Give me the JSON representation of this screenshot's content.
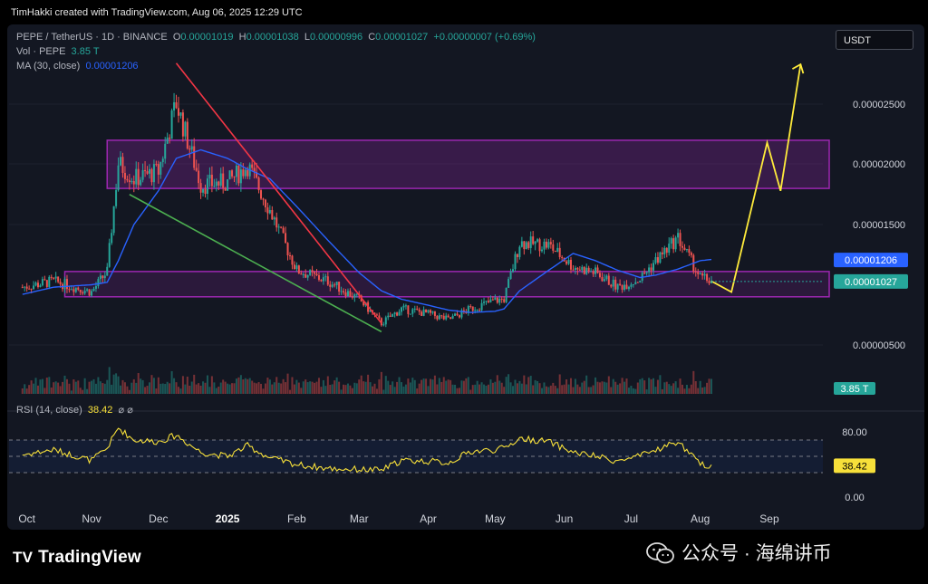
{
  "header": {
    "created_by": "TimHakki created with TradingView.com, Aug 06, 2025 12:29 UTC"
  },
  "symbol_line": {
    "pair": "PEPE / TetherUS · 1D · BINANCE",
    "o_label": "O",
    "o": "0.00001019",
    "h_label": "H",
    "h": "0.00001038",
    "l_label": "L",
    "l": "0.00000996",
    "c_label": "C",
    "c": "0.00001027",
    "change": "+0.00000007 (+0.69%)"
  },
  "volume_line": {
    "label": "Vol · PEPE",
    "value": "3.85 T"
  },
  "ma_line": {
    "label": "MA (30, close)",
    "value": "0.00001206"
  },
  "rsi_line": {
    "label": "RSI (14, close)",
    "value": "38.42",
    "icons": "⌀ ⌀"
  },
  "currency_button": "USDT",
  "price_axis": {
    "ticks": [
      "0.00002500",
      "0.00002000",
      "0.00001500",
      "0.00000500"
    ],
    "ma_badge": "0.00001206",
    "price_badge": "0.00001027",
    "volume_badge": "3.85 T"
  },
  "rsi_axis": {
    "ticks": [
      "80.00",
      "0.00"
    ],
    "rsi_badge": "38.42"
  },
  "time_axis": [
    "Oct",
    "Nov",
    "Dec",
    "2025",
    "Feb",
    "Mar",
    "Apr",
    "May",
    "Jun",
    "Jul",
    "Aug",
    "Sep"
  ],
  "branding": {
    "logo_text": "TradingView",
    "wechat_text": "公众号 · 海绵讲币"
  },
  "colors": {
    "up": "#26a69a",
    "down": "#ef5350",
    "ma": "#2962ff",
    "rsi": "#f7e03a",
    "zone": "#9c27b0",
    "projection": "#ffeb3b"
  },
  "chart_data": {
    "type": "candlestick",
    "title": "PEPE / TetherUS · 1D · BINANCE",
    "x": [
      "2024-10-01",
      "2024-10-15",
      "2024-11-01",
      "2024-11-08",
      "2024-11-13",
      "2024-11-20",
      "2024-12-01",
      "2024-12-09",
      "2024-12-20",
      "2025-01-01",
      "2025-01-10",
      "2025-01-20",
      "2025-02-01",
      "2025-02-15",
      "2025-03-01",
      "2025-03-11",
      "2025-03-20",
      "2025-04-01",
      "2025-04-10",
      "2025-04-20",
      "2025-05-01",
      "2025-05-05",
      "2025-05-12",
      "2025-05-25",
      "2025-06-05",
      "2025-06-15",
      "2025-06-25",
      "2025-07-05",
      "2025-07-12",
      "2025-07-22",
      "2025-08-01",
      "2025-08-06"
    ],
    "close": [
      9.8e-06,
      1.03e-05,
      9.4e-06,
      1.11e-05,
      2.01e-05,
      1.88e-05,
      1.94e-05,
      2.51e-05,
      1.83e-05,
      1.85e-05,
      1.99e-05,
      1.62e-05,
      1.12e-05,
      1.03e-05,
      8.8e-06,
      6.8e-06,
      8e-06,
      7.6e-06,
      7.1e-06,
      8e-06,
      8.7e-06,
      8.8e-06,
      1.35e-05,
      1.33e-05,
      1.15e-05,
      1.1e-05,
      9.8e-06,
      1.05e-05,
      1.2e-05,
      1.39e-05,
      1.06e-05,
      1.03e-05
    ],
    "ma30": [
      9.2e-06,
      9.8e-06,
      1e-05,
      1.02e-05,
      1.2e-05,
      1.5e-05,
      1.78e-05,
      2.05e-05,
      2.12e-05,
      2.05e-05,
      1.96e-05,
      1.88e-05,
      1.65e-05,
      1.37e-05,
      1.1e-05,
      9.5e-06,
      8.8e-06,
      8.3e-06,
      7.9e-06,
      7.7e-06,
      7.8e-06,
      8e-06,
      9.5e-06,
      1.12e-05,
      1.26e-05,
      1.2e-05,
      1.12e-05,
      1.06e-05,
      1.08e-05,
      1.13e-05,
      1.2e-05,
      1.21e-05
    ],
    "volume_last": "3.85 T",
    "rsi14": [
      52,
      58,
      45,
      60,
      85,
      70,
      68,
      76,
      55,
      50,
      63,
      48,
      40,
      35,
      34,
      33,
      45,
      44,
      42,
      56,
      58,
      60,
      72,
      68,
      55,
      50,
      44,
      50,
      58,
      68,
      40,
      38.42
    ],
    "rsi_levels": [
      70,
      30
    ],
    "zones": [
      {
        "name": "resistance",
        "from": 1.8e-05,
        "to": 2.2e-05
      },
      {
        "name": "support",
        "from": 9e-06,
        "to": 1.11e-05
      }
    ],
    "trendlines": [
      {
        "color": "red",
        "from": [
          "2024-12-09",
          2.84e-05
        ],
        "to": [
          "2025-03-11",
          6.8e-06
        ]
      },
      {
        "color": "green",
        "from": [
          "2024-11-18",
          1.75e-05
        ],
        "to": [
          "2025-03-11",
          6.1e-06
        ]
      }
    ],
    "projection": [
      [
        "2025-08-06",
        1.03e-05
      ],
      [
        "2025-08-15",
        9.4e-06
      ],
      [
        "2025-08-31",
        2.18e-05
      ],
      [
        "2025-09-06",
        1.78e-05
      ],
      [
        "2025-09-15",
        2.83e-05
      ]
    ],
    "xlabel": "",
    "ylabel": "",
    "ylim": [
      4e-06,
      3.1e-05
    ],
    "grid": false
  }
}
